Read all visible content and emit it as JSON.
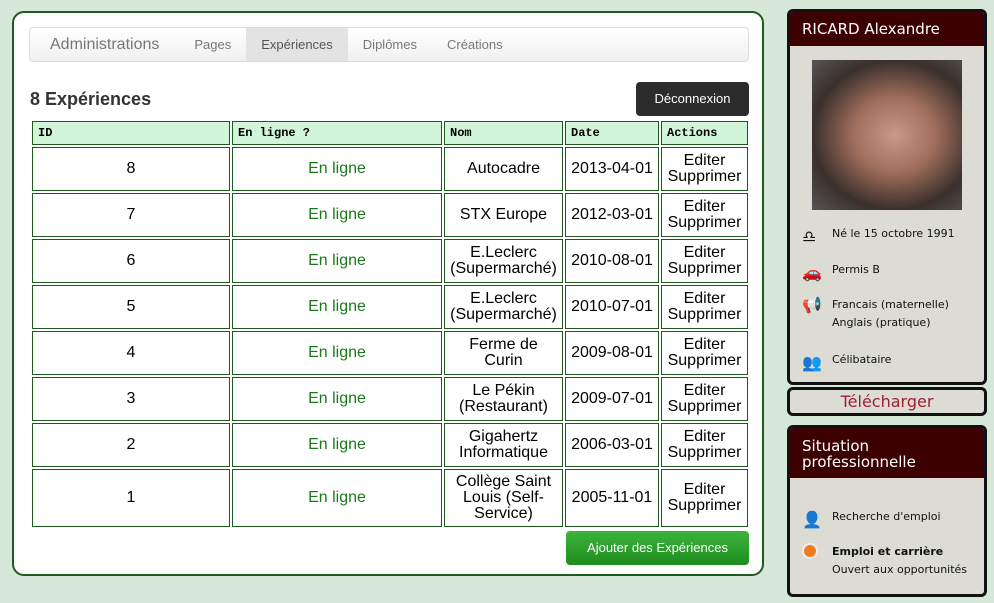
{
  "nav": {
    "brand": "Administrations",
    "items": [
      "Pages",
      "Expériences",
      "Diplômes",
      "Créations"
    ],
    "active": "Expériences"
  },
  "title": "8 Expériences",
  "logout": "Déconnexion",
  "table": {
    "headers": [
      "ID",
      "En ligne ?",
      "Nom",
      "Date",
      "Actions"
    ],
    "rows": [
      {
        "id": "8",
        "status": "En ligne",
        "nom": "Autocadre",
        "date": "2013-04-01"
      },
      {
        "id": "7",
        "status": "En ligne",
        "nom": "STX Europe",
        "date": "2012-03-01"
      },
      {
        "id": "6",
        "status": "En ligne",
        "nom": "E.Leclerc (Supermarché)",
        "date": "2010-08-01"
      },
      {
        "id": "5",
        "status": "En ligne",
        "nom": "E.Leclerc (Supermarché)",
        "date": "2010-07-01"
      },
      {
        "id": "4",
        "status": "En ligne",
        "nom": "Ferme de Curin",
        "date": "2009-08-01"
      },
      {
        "id": "3",
        "status": "En ligne",
        "nom": "Le Pékin (Restaurant)",
        "date": "2009-07-01"
      },
      {
        "id": "2",
        "status": "En ligne",
        "nom": "Gigahertz Informatique",
        "date": "2006-03-01"
      },
      {
        "id": "1",
        "status": "En ligne",
        "nom": "Collège Saint Louis (Self-Service)",
        "date": "2005-11-01"
      }
    ],
    "edit": "Editer",
    "delete": "Supprimer"
  },
  "add": "Ajouter des Expériences",
  "profile": {
    "name": "RICARD Alexandre",
    "birth": "Né le 15 octobre 1991",
    "license": "Permis B",
    "lang1": "Francais (maternelle)",
    "lang2": "Anglais (pratique)",
    "status": "Célibataire"
  },
  "download": "Télécharger",
  "situation": {
    "title": "Situation professionnelle",
    "search": "Recherche d'emploi",
    "career_title": "Emploi et carrière",
    "career_text": "Ouvert aux opportunités"
  }
}
